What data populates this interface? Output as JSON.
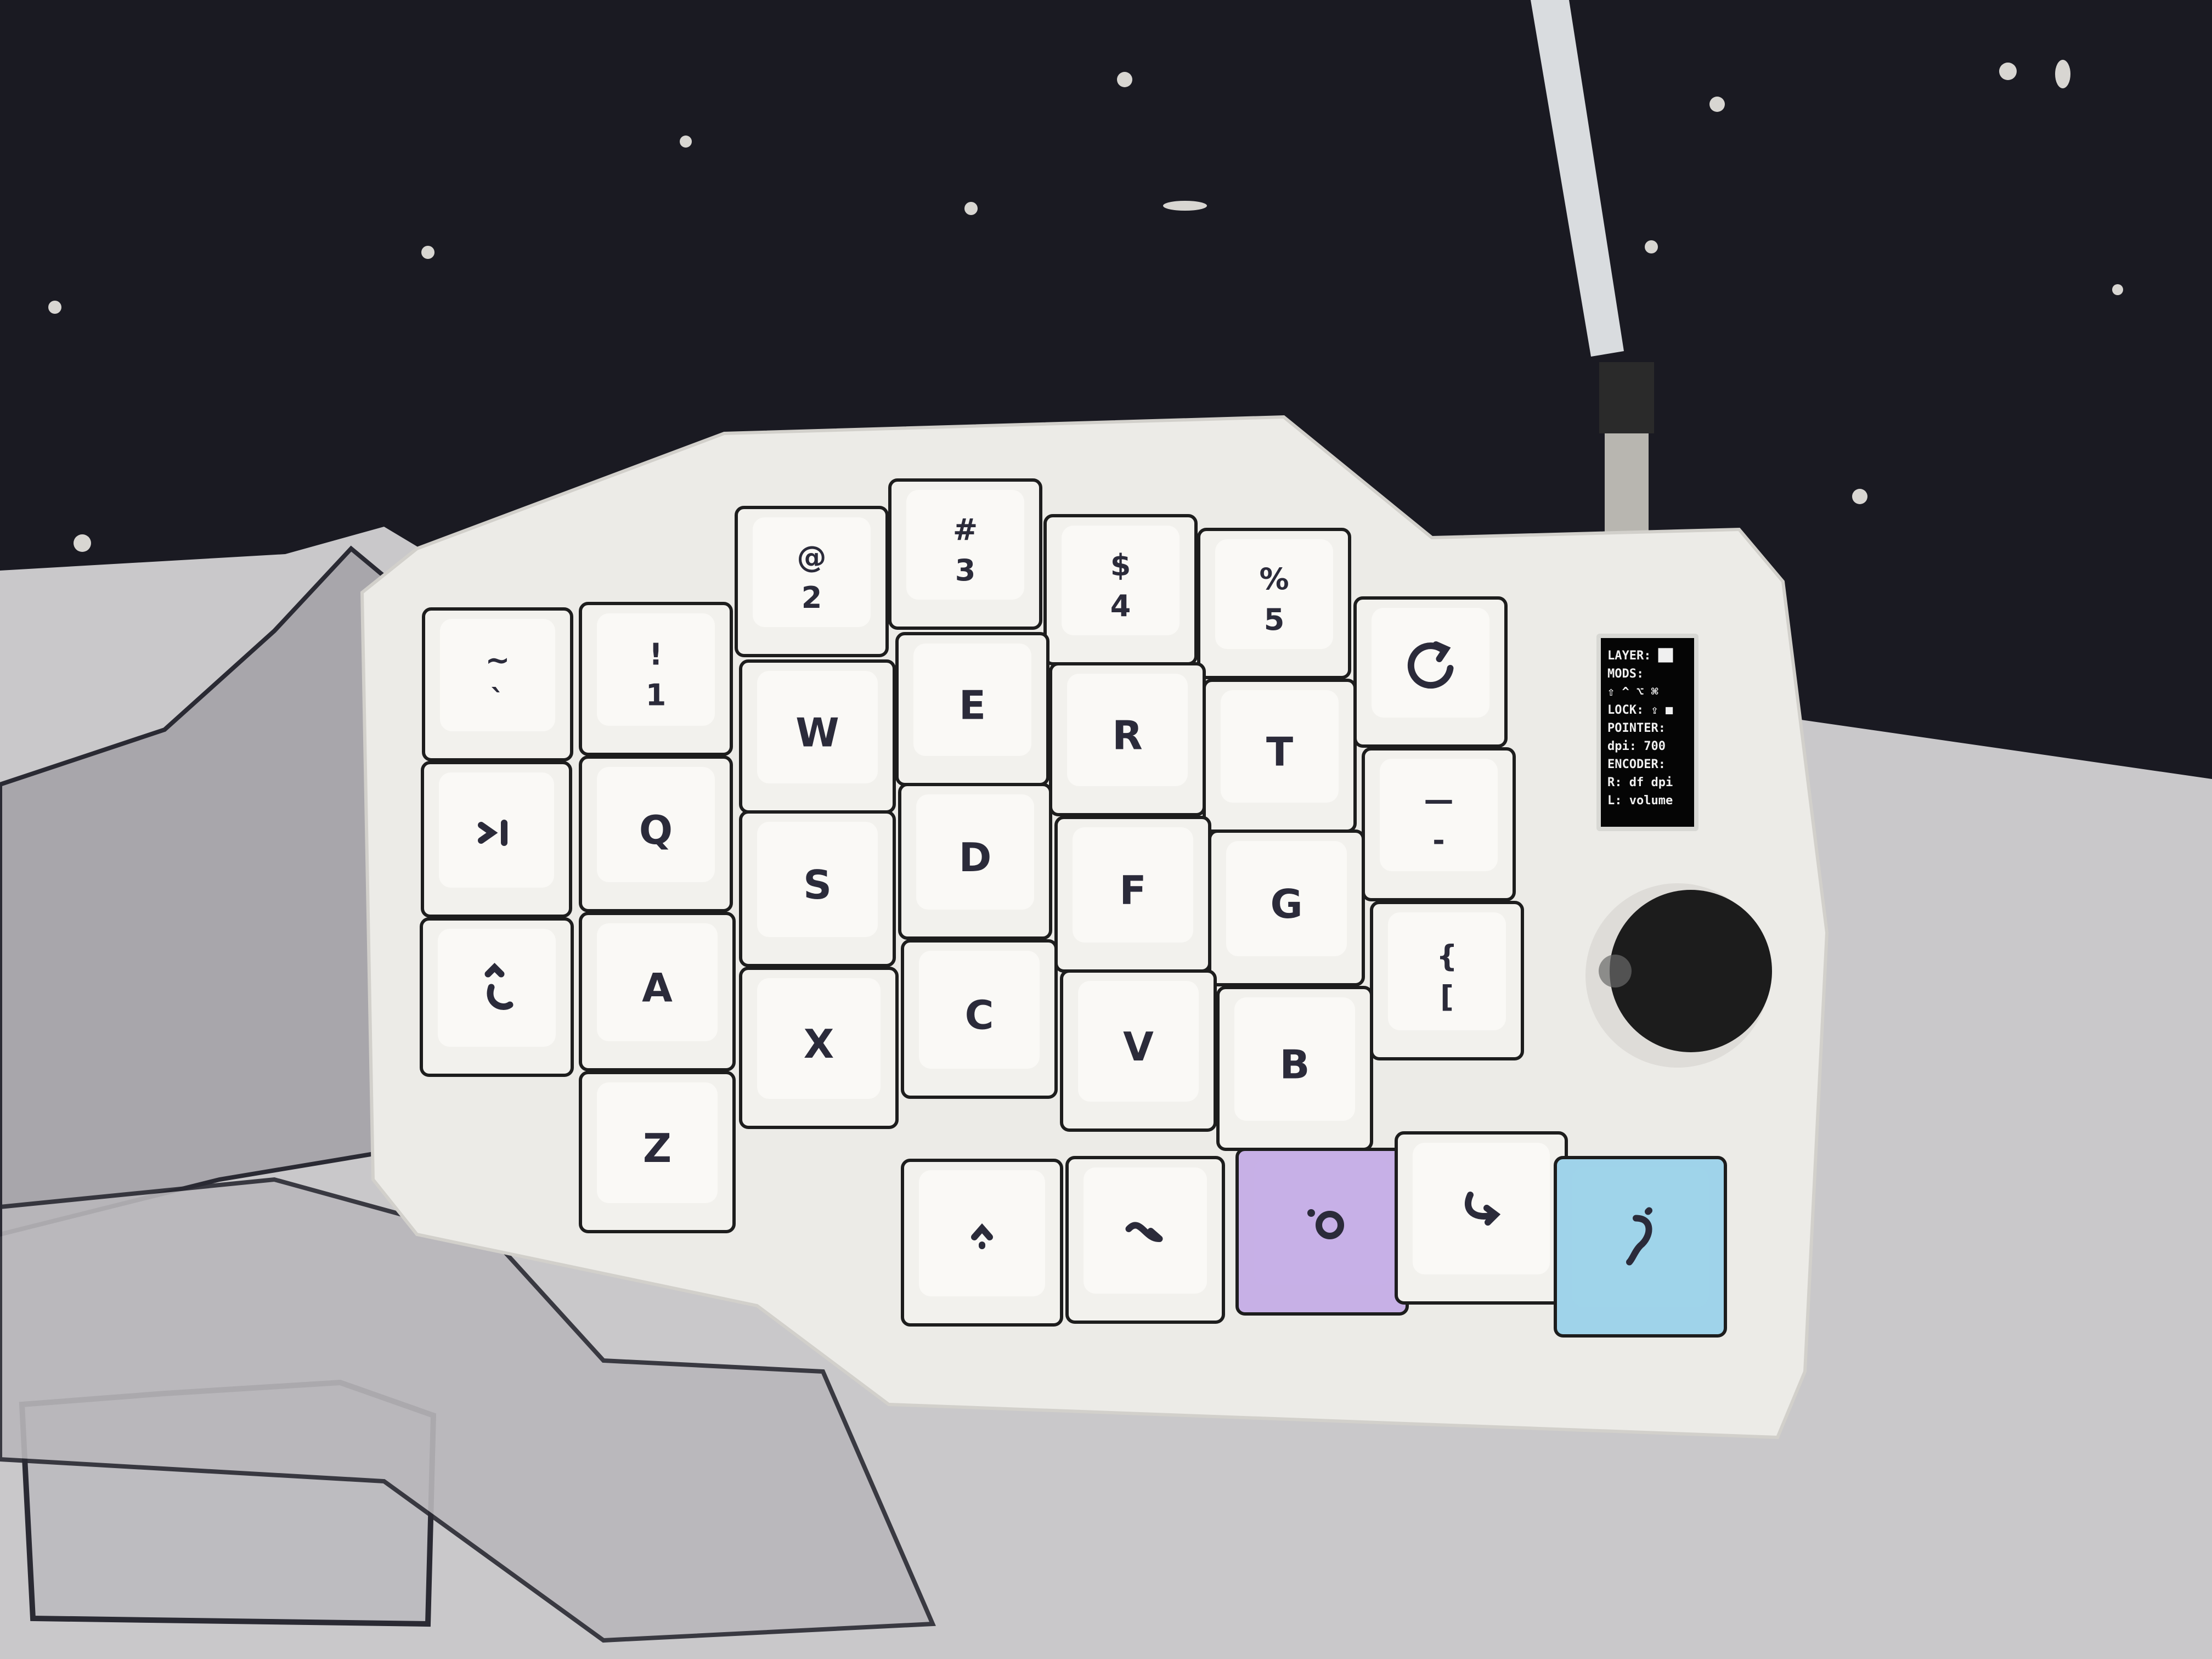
{
  "colors": {
    "mat_dark": "#1a1a22",
    "mat_light": "#c9c8ca",
    "case": "#ecebe7",
    "keycap": "#f2f1ed",
    "keycap_top": "#fbfaf7",
    "legend": "#2b2b3a",
    "purple_key": "#c7b0e6",
    "blue_key": "#9fd3ea",
    "knob": "#1c1c1c"
  },
  "keyboard": {
    "keys": [
      {
        "id": "tilde",
        "top": "~",
        "bottom": "`"
      },
      {
        "id": "1",
        "top": "!",
        "bottom": "1"
      },
      {
        "id": "2",
        "top": "@",
        "bottom": "2"
      },
      {
        "id": "3",
        "top": "#",
        "bottom": "3"
      },
      {
        "id": "4",
        "top": "$",
        "bottom": "4"
      },
      {
        "id": "5",
        "top": "%",
        "bottom": "5"
      },
      {
        "id": "refresh",
        "top": "",
        "bottom": "",
        "icon": "refresh-icon"
      },
      {
        "id": "tab",
        "top": "",
        "bottom": "",
        "icon": "tab-icon"
      },
      {
        "id": "q",
        "top": "",
        "bottom": "Q"
      },
      {
        "id": "w",
        "top": "",
        "bottom": "W"
      },
      {
        "id": "e",
        "top": "",
        "bottom": "E"
      },
      {
        "id": "r",
        "top": "",
        "bottom": "R"
      },
      {
        "id": "t",
        "top": "",
        "bottom": "T"
      },
      {
        "id": "minus",
        "top": "—",
        "bottom": "-"
      },
      {
        "id": "esc",
        "top": "",
        "bottom": "",
        "icon": "curved-arrow-icon"
      },
      {
        "id": "a",
        "top": "",
        "bottom": "A"
      },
      {
        "id": "s",
        "top": "",
        "bottom": "S"
      },
      {
        "id": "d",
        "top": "",
        "bottom": "D"
      },
      {
        "id": "f",
        "top": "",
        "bottom": "F"
      },
      {
        "id": "g",
        "top": "",
        "bottom": "G"
      },
      {
        "id": "bracket",
        "top": "{",
        "bottom": "["
      },
      {
        "id": "z",
        "top": "",
        "bottom": "Z"
      },
      {
        "id": "x",
        "top": "",
        "bottom": "X"
      },
      {
        "id": "c",
        "top": "",
        "bottom": "C"
      },
      {
        "id": "v",
        "top": "",
        "bottom": "V"
      },
      {
        "id": "b",
        "top": "",
        "bottom": "B"
      },
      {
        "id": "shift",
        "top": "",
        "bottom": "",
        "icon": "caret-up-icon"
      },
      {
        "id": "tilde-squiggle",
        "top": "",
        "bottom": "",
        "icon": "squiggle-icon"
      },
      {
        "id": "dot-circle",
        "top": "",
        "bottom": "",
        "icon": "dot-circle-icon"
      },
      {
        "id": "hook-arrow",
        "top": "",
        "bottom": "",
        "icon": "hook-arrow-icon"
      },
      {
        "id": "question",
        "top": "",
        "bottom": "",
        "icon": "question-squiggle-icon"
      }
    ]
  },
  "oled": {
    "lines": [
      "LAYER: ██",
      "MODS:",
      "⇧ ^ ⌥ ⌘",
      "LOCK: ⇪ ■",
      "POINTER:",
      "dpi:  700",
      "ENCODER:",
      "R: df dpi",
      "L: volume"
    ]
  }
}
